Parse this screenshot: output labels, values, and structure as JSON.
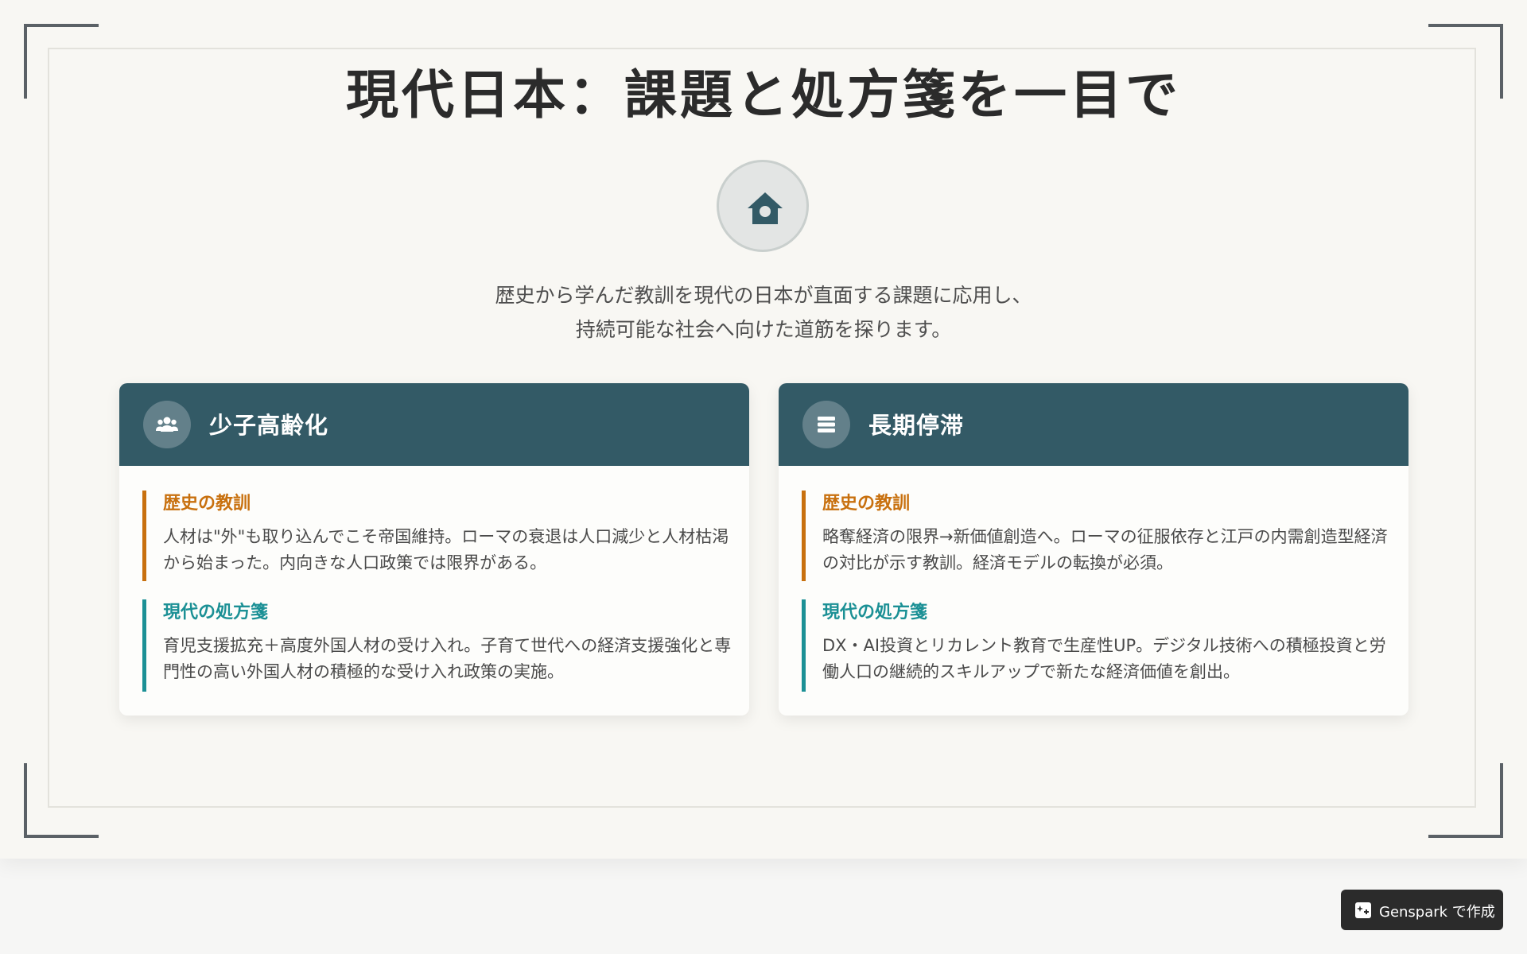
{
  "slide": {
    "title": "現代日本：課題と処方箋を一目で",
    "hero_icon": "house-icon",
    "intro_lines": [
      "歴史から学んだ教訓を現代の日本が直面する課題に応用し、",
      "持続可能な社会へ向けた道筋を探ります。"
    ]
  },
  "cards": [
    {
      "icon": "users-icon",
      "title": "少子高齢化",
      "lesson_label": "歴史の教訓",
      "lesson_text": "人材は\"外\"も取り込んでこそ帝国維持。ローマの衰退は人口減少と人材枯渇から始まった。内向きな人口政策では限界がある。",
      "remedy_label": "現代の処方箋",
      "remedy_text": "育児支援拡充＋高度外国人材の受け入れ。子育て世代への経済支援強化と専門性の高い外国人材の積極的な受け入れ政策の実施。"
    },
    {
      "icon": "bars-icon",
      "title": "長期停滞",
      "lesson_label": "歴史の教訓",
      "lesson_text": "略奪経済の限界→新価値創造へ。ローマの征服依存と江戸の内需創造型経済の対比が示す教訓。経済モデルの転換が必須。",
      "remedy_label": "現代の処方箋",
      "remedy_text": "DX・AI投資とリカレント教育で生産性UP。デジタル技術への積極投資と労働人口の継続的スキルアップで新たな経済価値を創出。"
    }
  ],
  "badge": {
    "label": "Genspark で作成",
    "icon": "spark-icon"
  },
  "colors": {
    "header": "#335a66",
    "lesson_accent": "#c8700e",
    "remedy_accent": "#1b9095"
  }
}
